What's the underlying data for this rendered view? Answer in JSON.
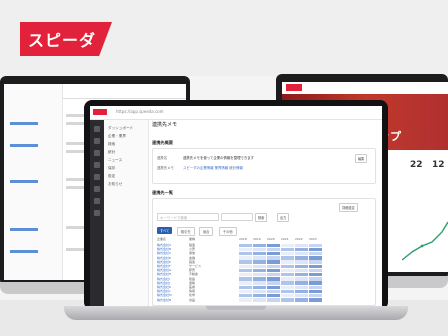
{
  "brand": {
    "logo_text": "スピーダ",
    "accent": "#e2213a"
  },
  "main": {
    "url": "https://app.speeda.com",
    "page_title": "連携先メモ",
    "nav": [
      "ダッシュボード",
      "企業・業界",
      "検索",
      "統計",
      "ニュース",
      "保存",
      "設定",
      "お知らせ"
    ],
    "sections": {
      "overview": "連携先概要",
      "list": "連携先一覧"
    },
    "overview": {
      "label1": "連携名",
      "value1": "連携先メモを使って企業の情報を整理できます",
      "label2": "連携先メモ",
      "value2": "スピーダの企業情報 業界情報 統計情報",
      "edit_button": "編集"
    },
    "list": {
      "search_placeholder": "キーワードで検索",
      "button_search": "検索",
      "button_export": "出力",
      "button_more": "詳細設定",
      "tabs": [
        "すべて",
        "取引先",
        "競合",
        "その他"
      ],
      "columns": [
        "企業名",
        "業種",
        "2018",
        "2019",
        "2020",
        "2021",
        "2022",
        "2023"
      ],
      "rows": [
        {
          "name": "株式会社A",
          "sector": "製造"
        },
        {
          "name": "株式会社B",
          "sector": "小売"
        },
        {
          "name": "株式会社C",
          "sector": "通信"
        },
        {
          "name": "株式会社D",
          "sector": "金融"
        },
        {
          "name": "株式会社E",
          "sector": "製造"
        },
        {
          "name": "株式会社F",
          "sector": "サービス"
        },
        {
          "name": "株式会社G",
          "sector": "卸売"
        },
        {
          "name": "株式会社H",
          "sector": "不動産"
        },
        {
          "name": "株式会社I",
          "sector": "建設"
        },
        {
          "name": "株式会社J",
          "sector": "運輸"
        },
        {
          "name": "株式会社K",
          "sector": "医療"
        },
        {
          "name": "株式会社L",
          "sector": "情報"
        },
        {
          "name": "株式会社M",
          "sector": "化学"
        },
        {
          "name": "株式会社N",
          "sector": "食品"
        }
      ]
    }
  },
  "right": {
    "hero_title": "ートアップ",
    "stat1": "22",
    "stat2": "12"
  }
}
